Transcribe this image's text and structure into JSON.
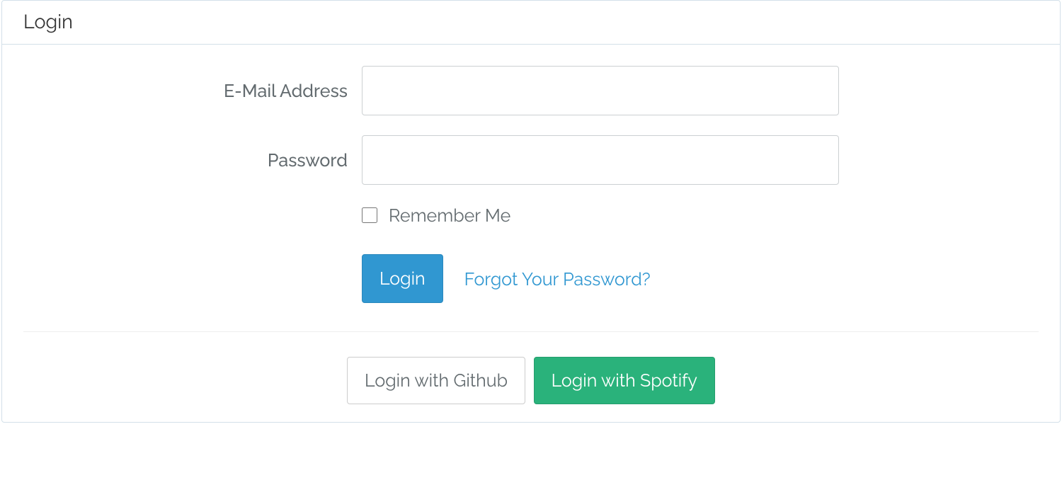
{
  "panel": {
    "title": "Login"
  },
  "form": {
    "email_label": "E-Mail Address",
    "email_value": "",
    "password_label": "Password",
    "password_value": "",
    "remember_label": "Remember Me",
    "submit_label": "Login",
    "forgot_link": "Forgot Your Password?"
  },
  "social": {
    "github_label": "Login with Github",
    "spotify_label": "Login with Spotify"
  }
}
